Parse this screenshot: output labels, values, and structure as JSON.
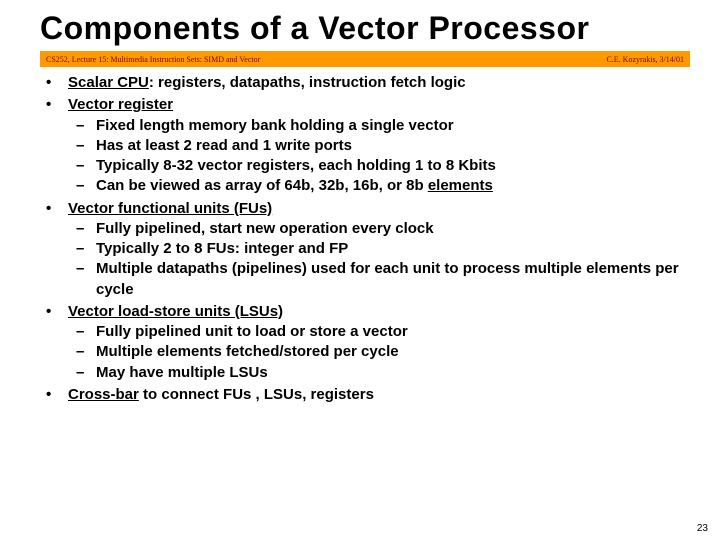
{
  "title": "Components of a Vector Processor",
  "bar": {
    "left": "CS252, Lecture 15: Multimedia Instruction Sets: SIMD and Vector",
    "right": "C.E. Kozyrakis, 3/14/01"
  },
  "b": [
    {
      "pre": "",
      "u": "Scalar CPU",
      "post": ": registers, datapaths, instruction fetch logic",
      "sub": []
    },
    {
      "pre": "",
      "u": "Vector register",
      "post": "",
      "sub": [
        "Fixed length memory bank holding a single vector",
        "Has at least 2 read and 1 write ports",
        "Typically 8-32 vector registers, each holding 1 to 8 Kbits",
        "Can be viewed as array of 64b, 32b, 16b, or 8b "
      ],
      "sub_tail_u": "elements"
    },
    {
      "pre": "",
      "u": "Vector functional units (FUs)",
      "post": "",
      "sub": [
        "Fully pipelined, start new operation every clock",
        "Typically 2 to 8 FUs: integer and FP",
        "Multiple datapaths (pipelines) used for each unit to process multiple elements per cycle"
      ]
    },
    {
      "pre": "",
      "u": "Vector load-store units (LSUs)",
      "post": "",
      "sub": [
        "Fully pipelined unit to load or store a vector",
        "Multiple elements fetched/stored per cycle",
        "May have multiple LSUs"
      ]
    },
    {
      "pre": "",
      "u": "Cross-bar",
      "post": " to connect FUs , LSUs, registers",
      "sub": []
    }
  ],
  "page": "23"
}
